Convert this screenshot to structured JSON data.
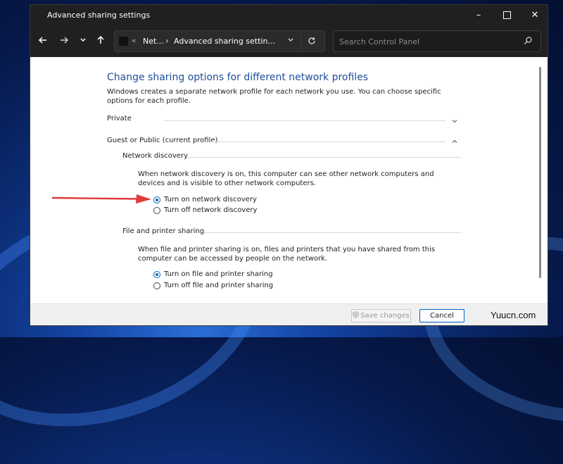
{
  "window": {
    "title": "Advanced sharing settings",
    "controls": {
      "minimize": "–",
      "maximize": "",
      "close": "✕"
    }
  },
  "nav": {
    "back_icon": "arrow-left-icon",
    "forward_icon": "arrow-right-icon",
    "recent_icon": "chevron-down-icon",
    "up_icon": "arrow-up-icon"
  },
  "address": {
    "overflow": "«",
    "crumb1": "Net...",
    "sep": "›",
    "crumb2": "Advanced sharing settin...",
    "dropdown": "⌄",
    "refresh": "↻"
  },
  "search": {
    "placeholder": "Search Control Panel",
    "value": ""
  },
  "main": {
    "heading": "Change sharing options for different network profiles",
    "description": "Windows creates a separate network profile for each network you use. You can choose specific options for each profile.",
    "private_label": "Private",
    "guest_label": "Guest or Public (current profile)",
    "network_discovery": {
      "title": "Network discovery",
      "description": "When network discovery is on, this computer can see other network computers and devices and is visible to other network computers.",
      "on_label": "Turn on network discovery",
      "off_label": "Turn off network discovery",
      "selected": "on"
    },
    "file_sharing": {
      "title": "File and printer sharing",
      "description": "When file and printer sharing is on, files and printers that you have shared from this computer can be accessed by people on the network.",
      "on_label": "Turn on file and printer sharing",
      "off_label": "Turn off file and printer sharing",
      "selected": "on"
    }
  },
  "footer": {
    "save_label": "Save changes",
    "cancel_label": "Cancel"
  },
  "watermark": "Yuucn.com",
  "colors": {
    "accent": "#0067c0",
    "heading": "#1f4e9e",
    "annotation_arrow": "#e03a3a"
  }
}
